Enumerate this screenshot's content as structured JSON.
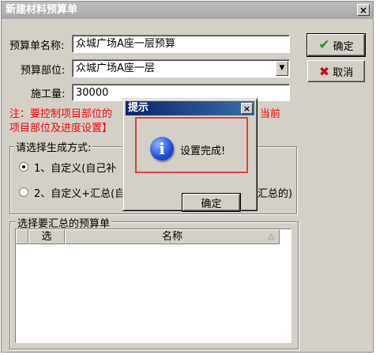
{
  "window": {
    "title": "新建材料预算单",
    "close_glyph": "×"
  },
  "form": {
    "budget_name_label": "预算单名称:",
    "budget_name_value": "众城广场A座一层预算",
    "budget_part_label": "预算部位:",
    "budget_part_value": "众城广场A座一层",
    "work_amount_label": "施工量:",
    "work_amount_value": "30000"
  },
  "buttons": {
    "ok_label": "确定",
    "cancel_label": "取消",
    "ok_icon": "✔",
    "cancel_icon": "✖"
  },
  "note": {
    "line1_left": "注：要控制项目部位的",
    "line1_right": "当前",
    "line2_left": "项目部位及进度设置】"
  },
  "generation": {
    "title": "请选择生成方式:",
    "option1": "1、自定义(自己补",
    "option2_left": "2、自定义+汇总(自",
    "option2_right": "汇总的)"
  },
  "summary": {
    "title": "选择要汇总的预算单",
    "col_select": "选",
    "col_name": "名称"
  },
  "dialog": {
    "title": "提示",
    "close_glyph": "×",
    "message": "设置完成!",
    "ok_label": "确定",
    "icon": "i"
  },
  "colors": {
    "note_red": "#ff0000",
    "highlight_red": "#e0403c",
    "ok_icon_green": "#1a9a1a",
    "cancel_icon_red": "#c01010",
    "dialog_title_blue": "#0a246a"
  }
}
